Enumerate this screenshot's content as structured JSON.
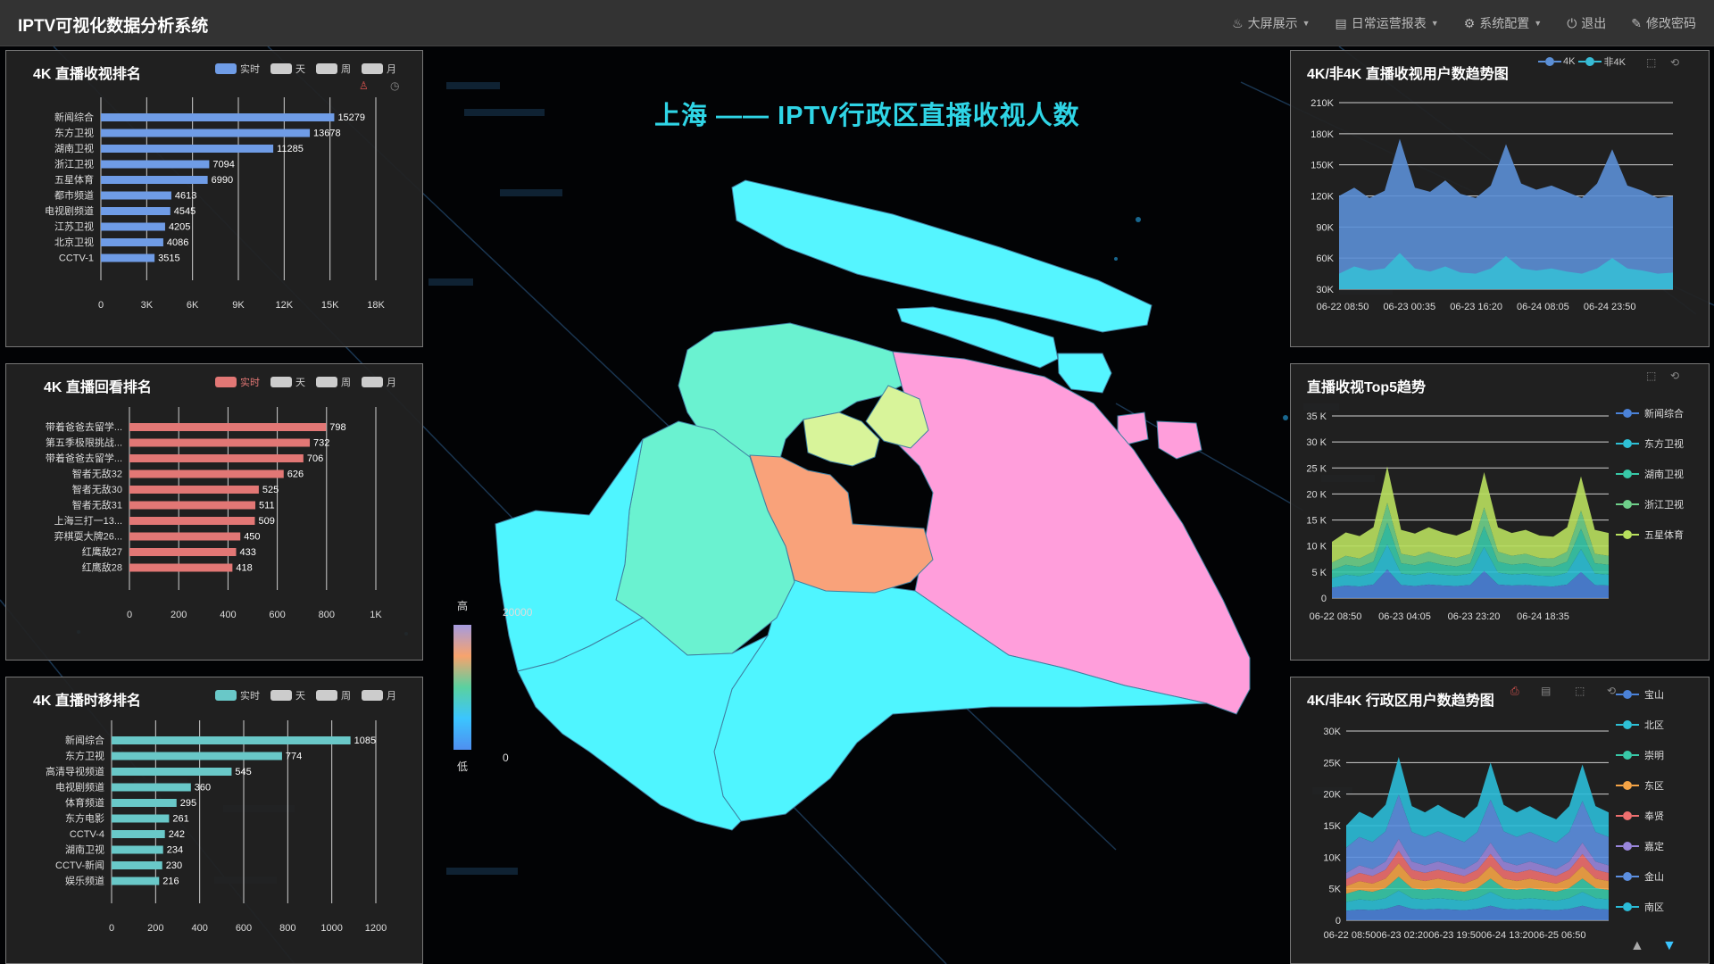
{
  "navbar": {
    "brand": "IPTV可视化数据分析系统",
    "items": [
      {
        "icon": "flame-icon",
        "label": "大屏展示",
        "dropdown": true
      },
      {
        "icon": "report-icon",
        "label": "日常运营报表",
        "dropdown": true
      },
      {
        "icon": "gear-icon",
        "label": "系统配置",
        "dropdown": true
      },
      {
        "icon": "power-icon",
        "label": "退出",
        "dropdown": false
      },
      {
        "icon": "edit-icon",
        "label": "修改密码",
        "dropdown": false
      }
    ]
  },
  "map": {
    "title": "上海 —— IPTV行政区直播收视人数",
    "visualmap": {
      "high_label": "高",
      "low_label": "低",
      "max": "20000",
      "min": "0"
    }
  },
  "legend_periods": [
    "实时",
    "天",
    "周",
    "月"
  ],
  "colors": {
    "live_rank": "#6f9ce6",
    "replay_rank": "#e27775",
    "timeshift_rank": "#69c8c8",
    "bg": "#000000",
    "panel": "#222222"
  },
  "panels": {
    "live_rank": {
      "title": "4K 直播收视排名"
    },
    "replay_rank": {
      "title": "4K 直播回看排名"
    },
    "timeshift_rank": {
      "title": "4K 直播时移排名"
    },
    "trend_4k": {
      "title": "4K/非4K 直播收视用户数趋势图",
      "legend": [
        "4K",
        "非4K"
      ]
    },
    "top5": {
      "title": "直播收视Top5趋势"
    },
    "district": {
      "title": "4K/非4K 行政区用户数趋势图"
    }
  },
  "chart_data": [
    {
      "type": "bar",
      "title": "4K 直播收视排名",
      "orientation": "horizontal",
      "categories": [
        "新闻综合",
        "东方卫视",
        "湖南卫视",
        "浙江卫视",
        "五星体育",
        "都市频道",
        "电视剧频道",
        "江苏卫视",
        "北京卫视",
        "CCTV-1"
      ],
      "values": [
        15279,
        13678,
        11285,
        7094,
        6990,
        4613,
        4545,
        4205,
        4086,
        3515
      ],
      "xlim": [
        0,
        18000
      ],
      "xticks": [
        "0",
        "3K",
        "6K",
        "9K",
        "12K",
        "15K",
        "18K"
      ]
    },
    {
      "type": "bar",
      "title": "4K 直播回看排名",
      "orientation": "horizontal",
      "categories": [
        "带着爸爸去留学...",
        "第五季极限挑战...",
        "带着爸爸去留学...",
        "智者无敌32",
        "智者无敌30",
        "智者无敌31",
        "上海三打一13...",
        "弈棋耍大牌26...",
        "红鹰敌27",
        "红鹰敌28"
      ],
      "values": [
        798,
        732,
        706,
        626,
        525,
        511,
        509,
        450,
        433,
        418
      ],
      "xlim": [
        0,
        1000
      ],
      "xticks": [
        "0",
        "200",
        "400",
        "600",
        "800",
        "1K"
      ]
    },
    {
      "type": "bar",
      "title": "4K 直播时移排名",
      "orientation": "horizontal",
      "categories": [
        "新闻综合",
        "东方卫视",
        "高清导视频道",
        "电视剧频道",
        "体育频道",
        "东方电影",
        "CCTV-4",
        "湖南卫视",
        "CCTV-新闻",
        "娱乐频道"
      ],
      "values": [
        1085,
        774,
        545,
        360,
        295,
        261,
        242,
        234,
        230,
        216
      ],
      "xlim": [
        0,
        1200
      ],
      "xticks": [
        "0",
        "200",
        "400",
        "600",
        "800",
        "1000",
        "1200"
      ]
    },
    {
      "type": "area",
      "title": "4K/非4K 直播收视用户数趋势图",
      "x_ticks": [
        "06-22 08:50",
        "06-23 00:35",
        "06-23 16:20",
        "06-24 08:05",
        "06-24 23:50"
      ],
      "yticks": [
        "30K",
        "60K",
        "90K",
        "120K",
        "150K",
        "180K",
        "210K"
      ],
      "ylim": [
        30000,
        210000
      ],
      "series": [
        {
          "name": "4K",
          "color": "#5b8fd6",
          "values": [
            120000,
            128000,
            118000,
            125000,
            175000,
            128000,
            124000,
            135000,
            122000,
            118000,
            130000,
            170000,
            132000,
            126000,
            130000,
            124000,
            118000,
            132000,
            165000,
            130000,
            125000,
            118000,
            120000
          ]
        },
        {
          "name": "非4K",
          "color": "#37bcd6",
          "values": [
            45000,
            52000,
            48000,
            50000,
            65000,
            50000,
            47000,
            52000,
            46000,
            45000,
            50000,
            62000,
            50000,
            48000,
            50000,
            47000,
            45000,
            50000,
            60000,
            50000,
            48000,
            45000,
            46000
          ]
        }
      ]
    },
    {
      "type": "area",
      "title": "直播收视Top5趋势",
      "stacked": true,
      "x_ticks": [
        "06-22 08:50",
        "06-23 04:05",
        "06-23 23:20",
        "06-24 18:35"
      ],
      "yticks": [
        "0",
        "5 K",
        "10 K",
        "15 K",
        "20 K",
        "25 K",
        "30 K",
        "35 K"
      ],
      "ylim": [
        0,
        35000
      ],
      "series": [
        {
          "name": "新闻综合",
          "color": "#4b82d8",
          "values": [
            2000,
            2400,
            2200,
            2600,
            5500,
            2500,
            2300,
            2600,
            2400,
            2300,
            2500,
            5200,
            2600,
            2400,
            2500,
            2300,
            2200,
            2600,
            5000,
            2500,
            2400
          ]
        },
        {
          "name": "东方卫视",
          "color": "#2ec0d6",
          "values": [
            1800,
            2100,
            2000,
            2300,
            4800,
            2200,
            2100,
            2300,
            2100,
            2000,
            2200,
            4600,
            2300,
            2100,
            2200,
            2000,
            2000,
            2300,
            4400,
            2200,
            2100
          ]
        },
        {
          "name": "湖南卫视",
          "color": "#38c9a8",
          "values": [
            1600,
            1900,
            1800,
            2100,
            4200,
            2000,
            1900,
            2100,
            1900,
            1800,
            2000,
            4000,
            2100,
            1900,
            2000,
            1800,
            1800,
            2100,
            3900,
            2000,
            1900
          ]
        },
        {
          "name": "浙江卫视",
          "color": "#6fd08a",
          "values": [
            1400,
            1700,
            1600,
            1900,
            3800,
            1800,
            1700,
            1900,
            1700,
            1600,
            1800,
            3600,
            1900,
            1700,
            1800,
            1600,
            1600,
            1900,
            3500,
            1800,
            1700
          ]
        },
        {
          "name": "五星体育",
          "color": "#b9e05e",
          "values": [
            4000,
            4500,
            4300,
            4700,
            7000,
            4600,
            4400,
            4700,
            4500,
            4300,
            4600,
            6800,
            4700,
            4400,
            4600,
            4300,
            4200,
            4700,
            6600,
            4600,
            4400
          ]
        }
      ]
    },
    {
      "type": "area",
      "title": "4K/非4K 行政区用户数趋势图",
      "stacked": true,
      "x_ticks": [
        "06-22 08:50",
        "06-23 02:20",
        "06-23 19:50",
        "06-24 13:20",
        "06-25 06:50"
      ],
      "yticks": [
        "0",
        "5K",
        "10K",
        "15K",
        "20K",
        "25K",
        "30K"
      ],
      "ylim": [
        0,
        30000
      ],
      "series": [
        {
          "name": "宝山",
          "color": "#4b82d8",
          "values": [
            1500,
            1700,
            1600,
            1800,
            2400,
            1800,
            1700,
            1800,
            1700,
            1600,
            1800,
            2300,
            1800,
            1700,
            1800,
            1700,
            1600,
            1800,
            2300,
            1800,
            1700
          ]
        },
        {
          "name": "北区",
          "color": "#2ec0d6",
          "values": [
            1400,
            1600,
            1500,
            1700,
            2300,
            1700,
            1600,
            1700,
            1600,
            1500,
            1700,
            2200,
            1700,
            1600,
            1700,
            1600,
            1500,
            1700,
            2200,
            1700,
            1600
          ]
        },
        {
          "name": "崇明",
          "color": "#38c9a8",
          "values": [
            1300,
            1500,
            1400,
            1600,
            2200,
            1600,
            1500,
            1600,
            1500,
            1400,
            1600,
            2100,
            1600,
            1500,
            1600,
            1500,
            1400,
            1600,
            2100,
            1600,
            1500
          ]
        },
        {
          "name": "东区",
          "color": "#f5a446",
          "values": [
            1200,
            1400,
            1300,
            1500,
            2100,
            1500,
            1400,
            1500,
            1400,
            1300,
            1500,
            2000,
            1500,
            1400,
            1500,
            1400,
            1300,
            1500,
            2000,
            1500,
            1400
          ]
        },
        {
          "name": "奉贤",
          "color": "#ee6f6f",
          "values": [
            1100,
            1300,
            1200,
            1400,
            2000,
            1400,
            1300,
            1400,
            1300,
            1200,
            1400,
            1900,
            1400,
            1300,
            1400,
            1300,
            1200,
            1400,
            1900,
            1400,
            1300
          ]
        },
        {
          "name": "嘉定",
          "color": "#9a86dc",
          "values": [
            1000,
            1200,
            1100,
            1300,
            1900,
            1300,
            1200,
            1300,
            1200,
            1100,
            1300,
            1800,
            1300,
            1200,
            1300,
            1200,
            1100,
            1300,
            1800,
            1300,
            1200
          ]
        },
        {
          "name": "金山",
          "color": "#5c8fe0",
          "values": [
            4000,
            4500,
            4300,
            4800,
            7000,
            4700,
            4500,
            4800,
            4500,
            4300,
            4700,
            6800,
            4800,
            4500,
            4700,
            4400,
            4200,
            4700,
            6600,
            4700,
            4500
          ]
        },
        {
          "name": "南区",
          "color": "#2bbcd8",
          "values": [
            3500,
            4000,
            3800,
            4200,
            6000,
            4100,
            3900,
            4200,
            3900,
            3800,
            4100,
            5900,
            4200,
            3900,
            4100,
            3800,
            3700,
            4100,
            5800,
            4100,
            3900
          ]
        }
      ]
    }
  ]
}
